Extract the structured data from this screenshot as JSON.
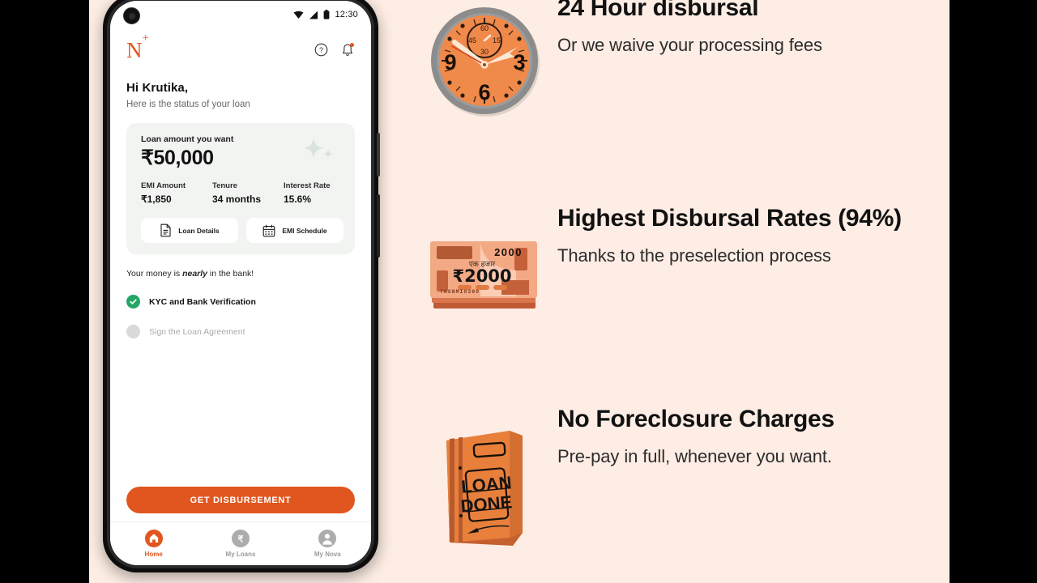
{
  "theme": {
    "background": "#FDEDE4",
    "accent": "#E1561E",
    "letterbox": "#000000",
    "success": "#23A566",
    "card_bg": "#F2F4F2"
  },
  "phone": {
    "status_bar": {
      "time": "12:30",
      "icons": [
        "wifi-icon",
        "signal-icon",
        "battery-icon"
      ]
    },
    "app_header": {
      "logo_letter": "N",
      "logo_plus": "+",
      "help_icon": "help-circle-icon",
      "notification_icon": "bell-icon"
    },
    "greeting": {
      "title": "Hi Krutika,",
      "subtitle": "Here is the status of your loan"
    },
    "loan_card": {
      "label": "Loan amount you want",
      "amount": "₹50,000",
      "stats": [
        {
          "label": "EMI Amount",
          "value": "₹1,850"
        },
        {
          "label": "Tenure",
          "value": "34 months"
        },
        {
          "label": "Interest Rate",
          "value": "15.6%"
        }
      ],
      "actions": [
        {
          "label": "Loan Details",
          "icon": "document-icon"
        },
        {
          "label": "EMI Schedule",
          "icon": "calendar-icon"
        }
      ]
    },
    "status_section": {
      "heading_before": "Your money is ",
      "heading_emphasis": "nearly",
      "heading_after": " in the bank!",
      "steps": [
        {
          "label": "KYC and Bank Verification",
          "state": "done"
        },
        {
          "label": "Sign the Loan Agreement",
          "state": "todo"
        }
      ]
    },
    "cta": {
      "label": "GET DISBURSEMENT"
    },
    "bottom_nav": [
      {
        "label": "Home",
        "icon": "home-icon",
        "active": true
      },
      {
        "label": "My Loans",
        "icon": "rupee-circle-icon",
        "active": false
      },
      {
        "label": "My Nova",
        "icon": "person-icon",
        "active": false
      }
    ]
  },
  "features": [
    {
      "art": "wall-clock-icon",
      "title": "24 Hour disbursal",
      "subtitle": "Or we waive your processing fees",
      "clock": {
        "numerals": [
          "9",
          "3",
          "6"
        ],
        "subdial": [
          "60",
          "15",
          "30",
          "45"
        ]
      }
    },
    {
      "art": "cash-stack-icon",
      "title": "Highest Disbursal Rates (94%)",
      "subtitle": "Thanks to the preselection process",
      "note": {
        "corner_value": "2000",
        "hindi": "एक हजार",
        "value": "₹2000",
        "serial": "7KSNMI0390"
      }
    },
    {
      "art": "loan-folder-icon",
      "title": "No Foreclosure Charges",
      "subtitle": "Pre-pay in full, whenever you want.",
      "folder": {
        "line1": "LOAN",
        "line2": "DONE"
      }
    }
  ]
}
